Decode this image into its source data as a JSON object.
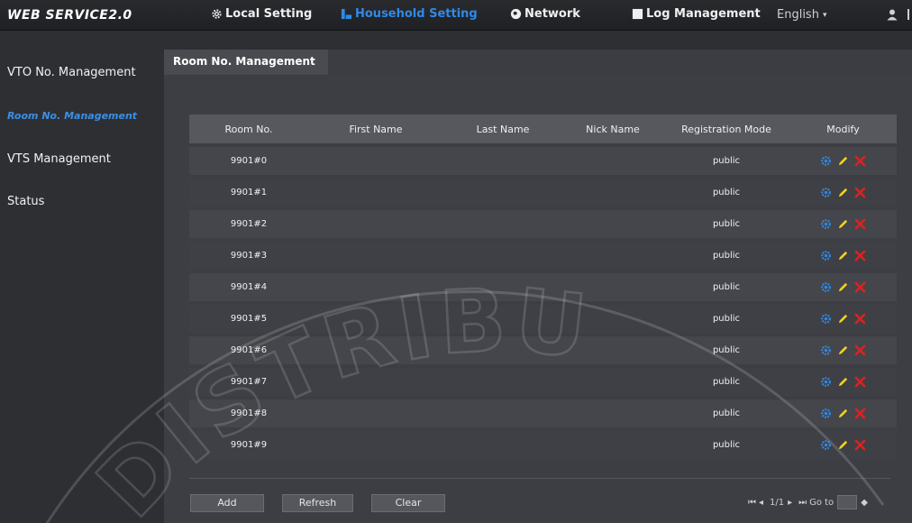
{
  "header": {
    "logo": "WEB SERVICE2.0",
    "nav": [
      {
        "label": "Local Setting",
        "icon": "gear-icon"
      },
      {
        "label": "Household Setting",
        "icon": "household-icon"
      },
      {
        "label": "Network",
        "icon": "globe-icon"
      },
      {
        "label": "Log Management",
        "icon": "log-icon"
      }
    ],
    "language": "English",
    "colors": {
      "active": "#2e8ae8",
      "accent_blue": "#2e8ae8",
      "delete_red": "#e02020",
      "edit_yellow": "#f2d21a"
    }
  },
  "sidebar": {
    "items": [
      {
        "label": "VTO No. Management"
      },
      {
        "label": "Room No. Management"
      },
      {
        "label": "VTS Management"
      },
      {
        "label": "Status"
      }
    ]
  },
  "tab": {
    "label": "Room No. Management"
  },
  "table": {
    "headers": [
      "Room No.",
      "First Name",
      "Last Name",
      "Nick Name",
      "Registration Mode",
      "Modify"
    ],
    "rows": [
      {
        "room": "9901#0",
        "first": "",
        "last": "",
        "nick": "",
        "mode": "public"
      },
      {
        "room": "9901#1",
        "first": "",
        "last": "",
        "nick": "",
        "mode": "public"
      },
      {
        "room": "9901#2",
        "first": "",
        "last": "",
        "nick": "",
        "mode": "public"
      },
      {
        "room": "9901#3",
        "first": "",
        "last": "",
        "nick": "",
        "mode": "public"
      },
      {
        "room": "9901#4",
        "first": "",
        "last": "",
        "nick": "",
        "mode": "public"
      },
      {
        "room": "9901#5",
        "first": "",
        "last": "",
        "nick": "",
        "mode": "public"
      },
      {
        "room": "9901#6",
        "first": "",
        "last": "",
        "nick": "",
        "mode": "public"
      },
      {
        "room": "9901#7",
        "first": "",
        "last": "",
        "nick": "",
        "mode": "public"
      },
      {
        "room": "9901#8",
        "first": "",
        "last": "",
        "nick": "",
        "mode": "public"
      },
      {
        "room": "9901#9",
        "first": "",
        "last": "",
        "nick": "",
        "mode": "public"
      }
    ]
  },
  "buttons": {
    "add": "Add",
    "refresh": "Refresh",
    "clear": "Clear"
  },
  "pager": {
    "page": "1/1",
    "goto_label": "Go to",
    "goto_value": ""
  },
  "watermark": {
    "text": "DISTRIBU"
  }
}
